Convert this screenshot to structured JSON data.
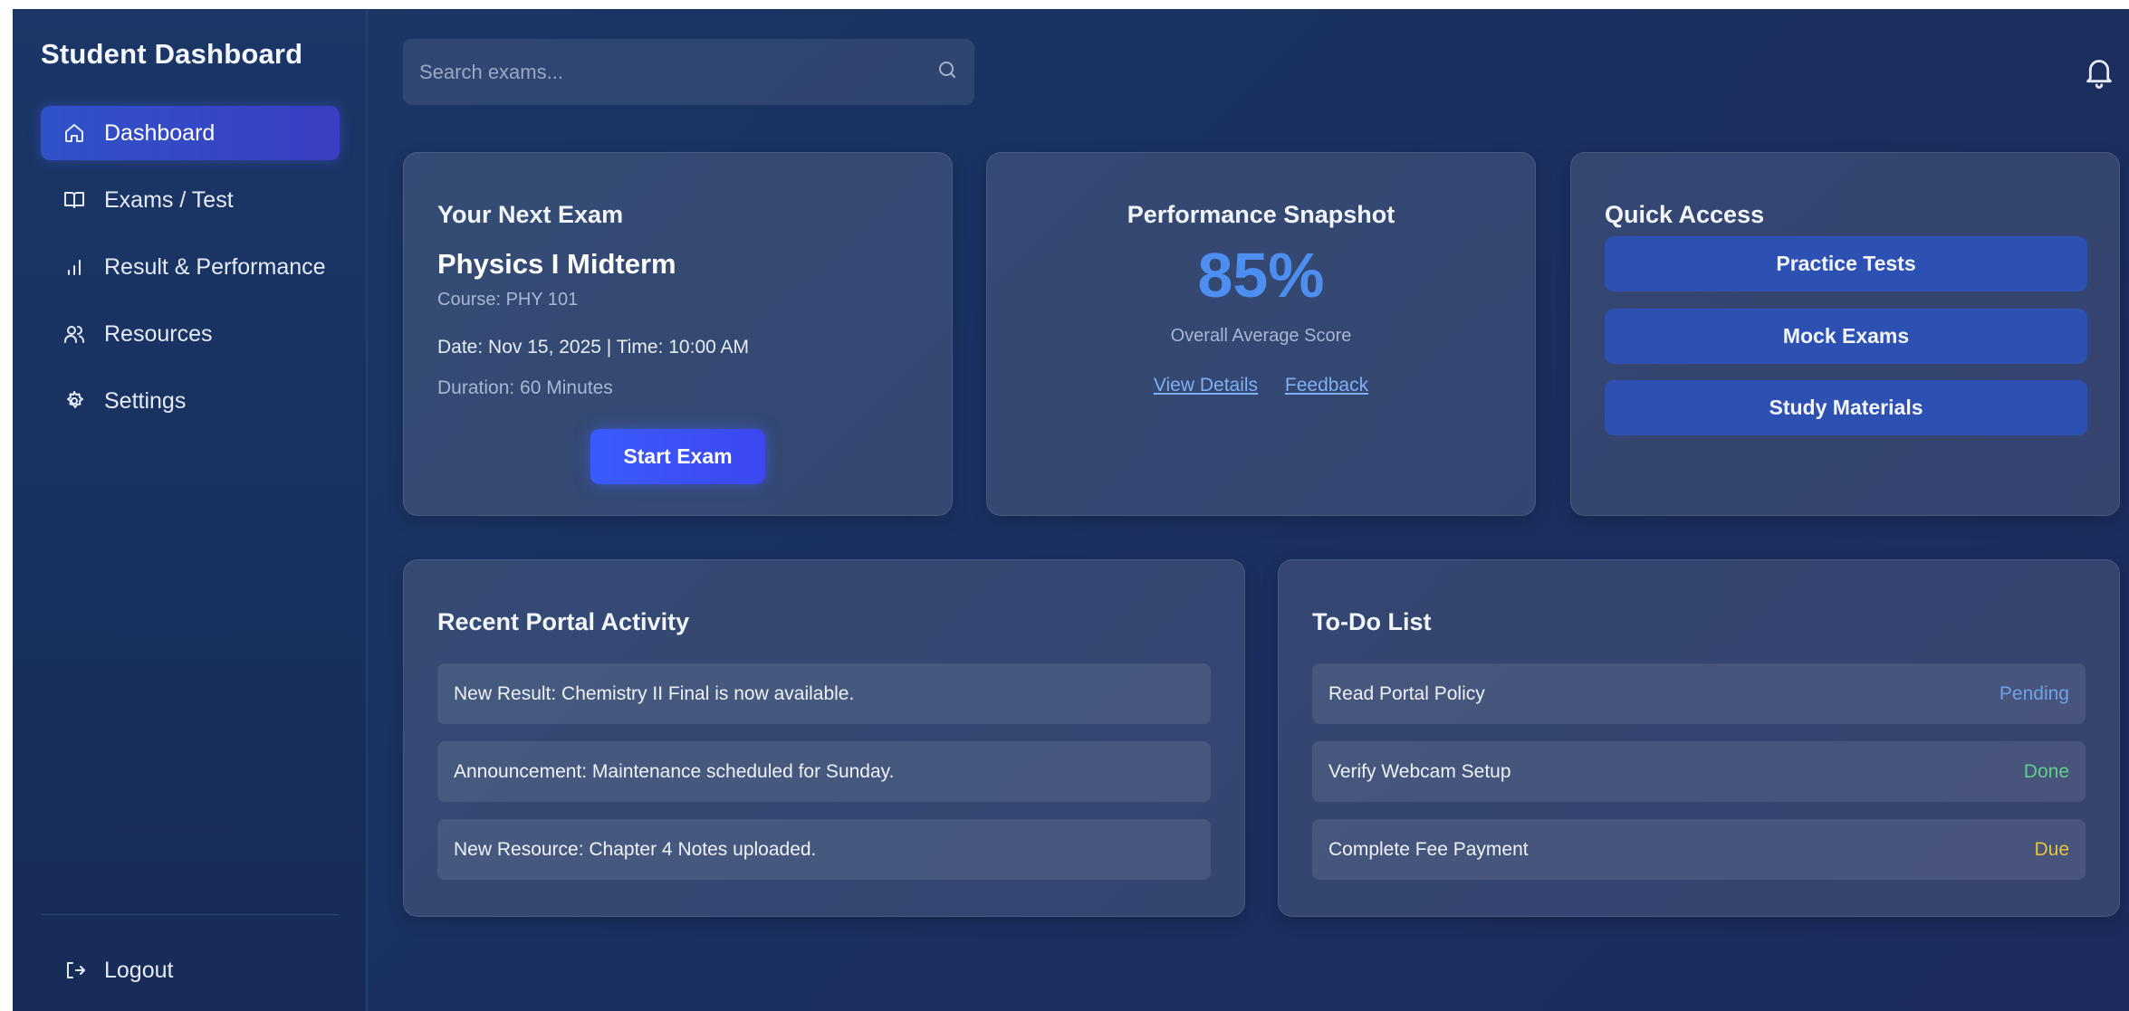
{
  "sidebar": {
    "title": "Student Dashboard",
    "items": [
      {
        "label": "Dashboard",
        "icon": "home-icon",
        "active": true
      },
      {
        "label": "Exams / Test",
        "icon": "book-open-icon",
        "active": false
      },
      {
        "label": "Result & Performance",
        "icon": "bar-chart-icon",
        "active": false
      },
      {
        "label": "Resources",
        "icon": "users-icon",
        "active": false
      },
      {
        "label": "Settings",
        "icon": "gear-icon",
        "active": false
      }
    ],
    "logout_label": "Logout"
  },
  "search": {
    "placeholder": "Search exams..."
  },
  "next_exam": {
    "title": "Your Next Exam",
    "exam_name": "Physics I Midterm",
    "course": "Course: PHY 101",
    "date_time": "Date: Nov 15, 2025 | Time: 10:00 AM",
    "duration": "Duration: 60 Minutes",
    "button_label": "Start Exam"
  },
  "performance": {
    "title": "Performance Snapshot",
    "score": "85%",
    "score_label": "Overall Average Score",
    "link_details": "View Details",
    "link_feedback": "Feedback"
  },
  "quick_access": {
    "title": "Quick Access",
    "buttons": [
      "Practice Tests",
      "Mock Exams",
      "Study Materials"
    ]
  },
  "activity": {
    "title": "Recent Portal Activity",
    "items": [
      "New Result: Chemistry II Final is now available.",
      "Announcement: Maintenance scheduled for Sunday.",
      "New Resource: Chapter 4 Notes uploaded."
    ]
  },
  "todo": {
    "title": "To-Do List",
    "items": [
      {
        "task": "Read Portal Policy",
        "status": "Pending",
        "color": "#6fa3e8"
      },
      {
        "task": "Verify Webcam Setup",
        "status": "Done",
        "color": "#5fd08a"
      },
      {
        "task": "Complete Fee Payment",
        "status": "Due",
        "color": "#e8c43c"
      }
    ]
  }
}
